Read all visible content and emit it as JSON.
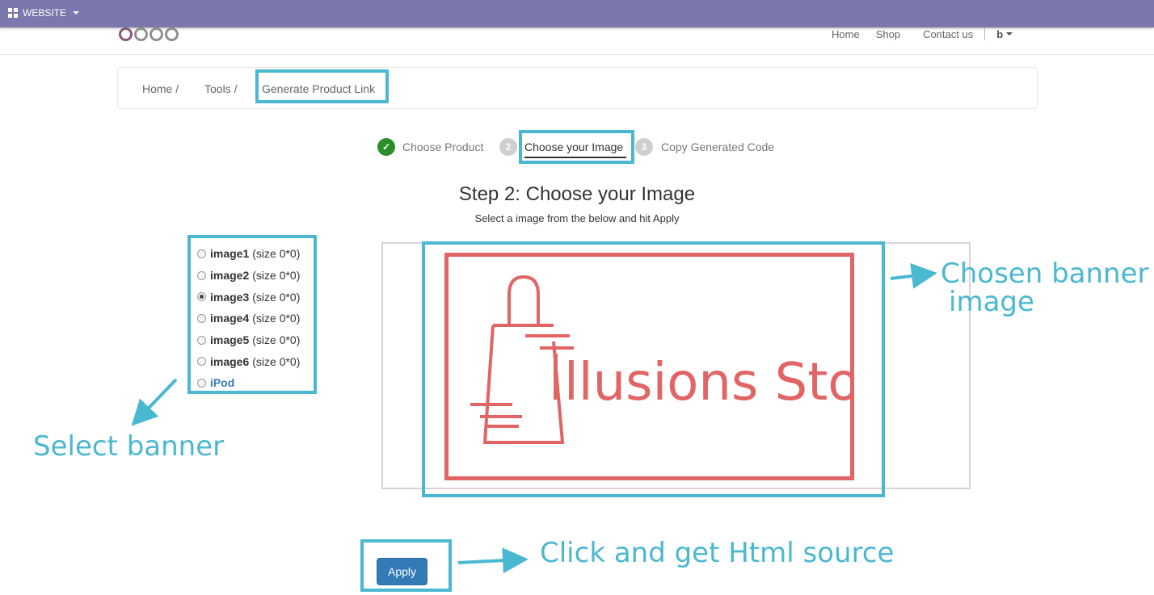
{
  "topbar": {
    "menu_label": "WEBSITE"
  },
  "nav": {
    "links": [
      "Home",
      "Shop",
      "Contact us"
    ],
    "user": "b"
  },
  "breadcrumb": {
    "items": [
      "Home /",
      "Tools /",
      "Generate Product Link"
    ]
  },
  "wizard": {
    "steps": [
      {
        "number": "✓",
        "label": "Choose Product",
        "state": "done"
      },
      {
        "number": "2",
        "label": "Choose your Image",
        "state": "active"
      },
      {
        "number": "3",
        "label": "Copy Generated Code",
        "state": "todo"
      }
    ]
  },
  "content": {
    "title": "Step 2: Choose your Image",
    "subtitle": "Select a image from the below and hit Apply"
  },
  "images": [
    {
      "name": "image1",
      "size": "(size 0*0)",
      "checked": false
    },
    {
      "name": "image2",
      "size": "(size 0*0)",
      "checked": false
    },
    {
      "name": "image3",
      "size": "(size 0*0)",
      "checked": true
    },
    {
      "name": "image4",
      "size": "(size 0*0)",
      "checked": false
    },
    {
      "name": "image5",
      "size": "(size 0*0)",
      "checked": false
    },
    {
      "name": "image6",
      "size": "(size 0*0)",
      "checked": false
    },
    {
      "name": "iPod",
      "size": "",
      "checked": false
    }
  ],
  "banner": {
    "text": "llusions Store",
    "color": "#e26464"
  },
  "annotations": {
    "chosen_line1": "Chosen banner",
    "chosen_line2": "image",
    "select": "Select banner",
    "click": "Click and get Html source",
    "color": "#4bb8d1"
  },
  "apply_label": "Apply"
}
